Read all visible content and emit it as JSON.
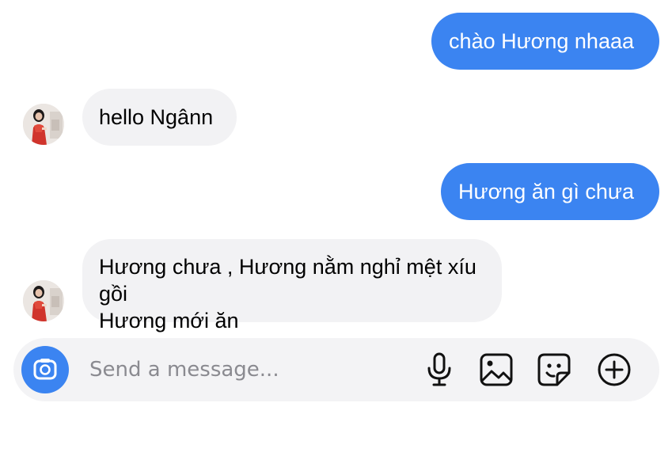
{
  "conversation": {
    "messages": [
      {
        "direction": "outgoing",
        "text": "chào Hương nhaaa"
      },
      {
        "direction": "incoming",
        "text": "hello Ngânn"
      },
      {
        "direction": "outgoing",
        "text": "Hương ăn gì chưa"
      },
      {
        "direction": "incoming",
        "lines": [
          "Hương chưa , Hương nằm nghỉ mệt xíu gồi",
          "Hương mới ăn"
        ]
      }
    ]
  },
  "composer": {
    "placeholder": "Send a message...",
    "icons": [
      "camera-icon",
      "microphone-icon",
      "gallery-icon",
      "sticker-icon",
      "plus-icon"
    ]
  },
  "colors": {
    "outgoing_bubble": "#3b84f1",
    "incoming_bubble": "#f2f2f4",
    "composer_bg": "#f3f3f5"
  }
}
